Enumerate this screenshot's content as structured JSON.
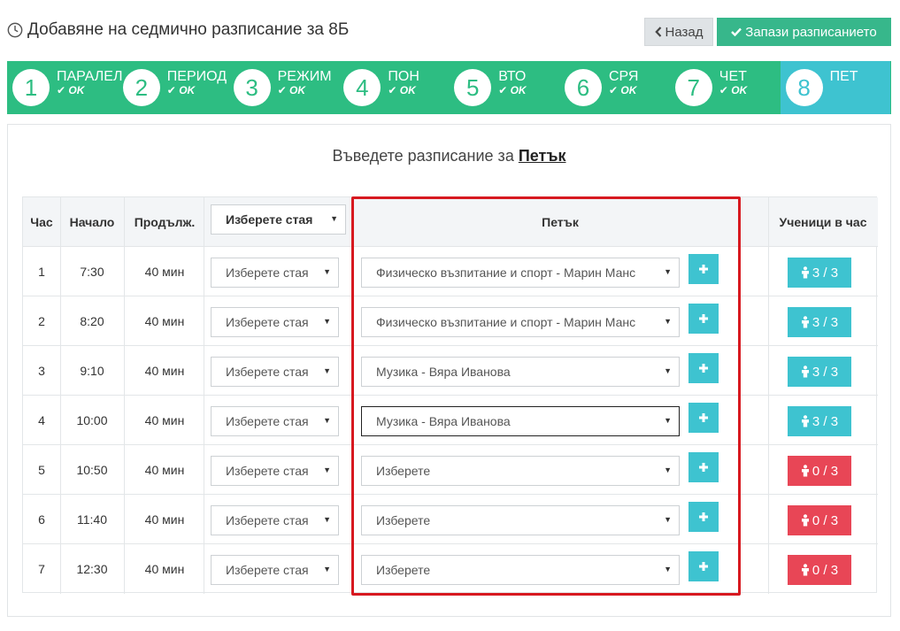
{
  "header": {
    "title": "Добавяне на седмично разписание за 8Б"
  },
  "toolbar": {
    "back_label": "Назад",
    "save_label": "Запази разписанието"
  },
  "colors": {
    "accent_green": "#2dbd82",
    "active_cyan": "#3ec3d0",
    "danger_red": "#e84656",
    "highlight": "#d71920"
  },
  "wizard": {
    "steps": [
      {
        "num": "1",
        "label": "ПАРАЛЕЛ",
        "status": "OK"
      },
      {
        "num": "2",
        "label": "ПЕРИОД",
        "status": "OK"
      },
      {
        "num": "3",
        "label": "РЕЖИМ",
        "status": "OK"
      },
      {
        "num": "4",
        "label": "ПОН",
        "status": "OK"
      },
      {
        "num": "5",
        "label": "ВТО",
        "status": "OK"
      },
      {
        "num": "6",
        "label": "СРЯ",
        "status": "OK"
      },
      {
        "num": "7",
        "label": "ЧЕТ",
        "status": "OK"
      },
      {
        "num": "8",
        "label": "ПЕТ",
        "status": ""
      }
    ]
  },
  "main": {
    "prompt_text": "Въведете разписание за",
    "prompt_day": "Петък",
    "table": {
      "headers": {
        "hour": "Час",
        "start": "Начало",
        "duration": "Продълж.",
        "room_select": "Изберете стая",
        "day": "Петък",
        "students": "Ученици в час"
      },
      "rows": [
        {
          "hour": "1",
          "start": "7:30",
          "duration": "40 мин",
          "room": "Изберете стая",
          "subject": "Физическо възпитание и спорт - Марин Манс",
          "students": "3 / 3",
          "status": "ok"
        },
        {
          "hour": "2",
          "start": "8:20",
          "duration": "40 мин",
          "room": "Изберете стая",
          "subject": "Физическо възпитание и спорт - Марин Манс",
          "students": "3 / 3",
          "status": "ok"
        },
        {
          "hour": "3",
          "start": "9:10",
          "duration": "40 мин",
          "room": "Изберете стая",
          "subject": "Музика - Вяра Иванова",
          "students": "3 / 3",
          "status": "ok"
        },
        {
          "hour": "4",
          "start": "10:00",
          "duration": "40 мин",
          "room": "Изберете стая",
          "subject": "Музика - Вяра Иванова",
          "students": "3 / 3",
          "status": "ok"
        },
        {
          "hour": "5",
          "start": "10:50",
          "duration": "40 мин",
          "room": "Изберете стая",
          "subject": "Изберете",
          "students": "0 / 3",
          "status": "empty"
        },
        {
          "hour": "6",
          "start": "11:40",
          "duration": "40 мин",
          "room": "Изберете стая",
          "subject": "Изберете",
          "students": "0 / 3",
          "status": "empty"
        },
        {
          "hour": "7",
          "start": "12:30",
          "duration": "40 мин",
          "room": "Изберете стая",
          "subject": "Изберете",
          "students": "0 / 3",
          "status": "empty"
        }
      ]
    }
  }
}
